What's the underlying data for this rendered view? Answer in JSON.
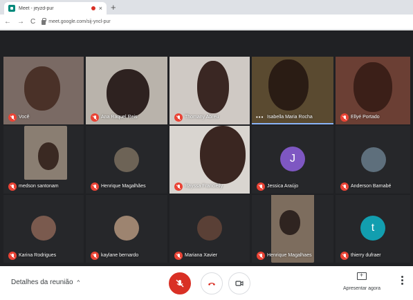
{
  "browser": {
    "tab_title": "Meet - jeyzd-pur",
    "tab_close": "×",
    "new_tab": "+",
    "back": "←",
    "forward": "→",
    "reload": "C",
    "url": "meet.google.com/sij-yncl-pur"
  },
  "meeting": {
    "participants": [
      {
        "name": "Você",
        "state": "muted"
      },
      {
        "name": "Ana Raquel Reis",
        "state": "muted"
      },
      {
        "name": "Thomany Abreu",
        "state": "muted"
      },
      {
        "name": "Isabella Maria Rocha",
        "state": "speaking"
      },
      {
        "name": "Ellyé Portado",
        "state": "muted"
      },
      {
        "name": "medson santonam",
        "state": "muted"
      },
      {
        "name": "Henrique Magalhães",
        "state": "muted"
      },
      {
        "name": "Rayssa Francielly",
        "state": "muted"
      },
      {
        "name": "Jessica Araújo",
        "state": "muted",
        "avatar_letter": "J",
        "avatar_color": "#7e57c2"
      },
      {
        "name": "Anderson Barnabé",
        "state": "muted"
      },
      {
        "name": "Karina Rodrigues",
        "state": "muted"
      },
      {
        "name": "kaylane bernardo",
        "state": "muted"
      },
      {
        "name": "Mariana Xavier",
        "state": "muted"
      },
      {
        "name": "Henrique Magalhaes",
        "state": "muted"
      },
      {
        "name": "thierry dufraer",
        "state": "muted",
        "avatar_letter": "t",
        "avatar_color": "#129eaf"
      }
    ]
  },
  "toolbar": {
    "details_label": "Detalhes da reunião",
    "details_chevron": "^",
    "present_label": "Apresentar agora"
  },
  "colors": {
    "mute_red": "#ea4335",
    "stage_bg": "#202124",
    "tile_bg": "#3c4043",
    "active_speaker": "#8ab4f8"
  }
}
